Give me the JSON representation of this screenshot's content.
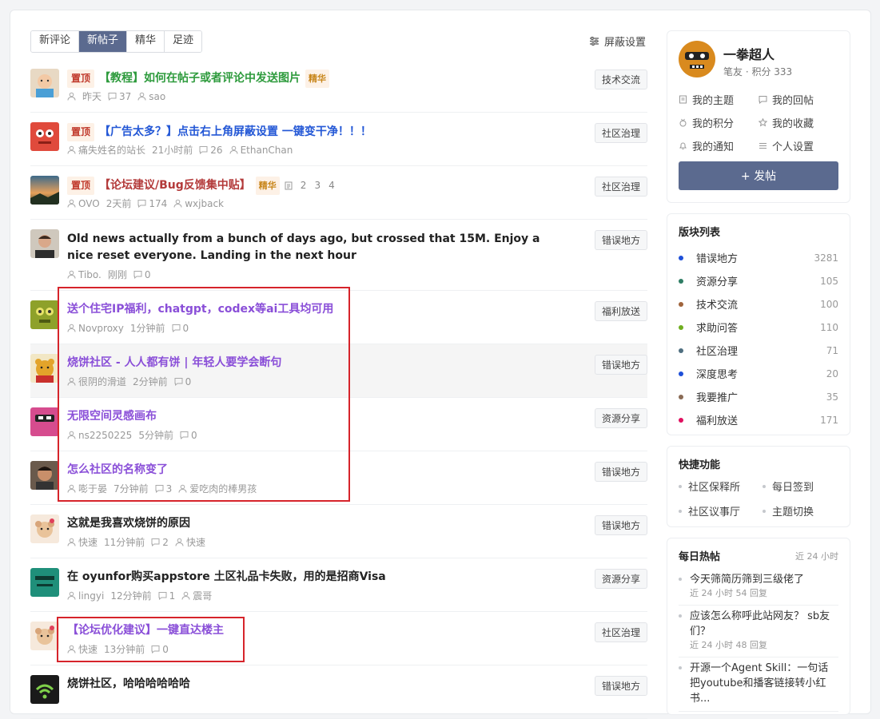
{
  "tabs": [
    {
      "label": "新评论",
      "active": false
    },
    {
      "label": "新帖子",
      "active": true
    },
    {
      "label": "精华",
      "active": false
    },
    {
      "label": "足迹",
      "active": false
    }
  ],
  "block_settings": "屏蔽设置",
  "posts": [
    {
      "pinned": "置顶",
      "title": "【教程】如何在帖子或者评论中发送图片",
      "best": "精华",
      "time": "昨天",
      "replies": "37",
      "last": "sao",
      "category": "技术交流"
    },
    {
      "pinned": "置顶",
      "title": "【广告太多？】点击右上角屏蔽设置 一键变干净！！！",
      "author": "痛失姓名的站长",
      "time": "21小时前",
      "replies": "26",
      "last": "EthanChan",
      "category": "社区治理"
    },
    {
      "pinned": "置顶",
      "title": "【论坛建议/Bug反馈集中贴】",
      "best": "精华",
      "pages": [
        "2",
        "3",
        "4"
      ],
      "author": "OVO",
      "time": "2天前",
      "replies": "174",
      "last": "wxjback",
      "category": "社区治理"
    },
    {
      "title": "Old news actually from a bunch of days ago, but crossed that 15M. Enjoy a nice reset everyone. Landing in the next hour",
      "author": "Tibo.",
      "time": "刚刚",
      "replies": "0",
      "category": "错误地方"
    },
    {
      "title": "送个住宅IP福利，chatgpt，codex等ai工具均可用",
      "author": "Novproxy",
      "time": "1分钟前",
      "replies": "0",
      "category": "福利放送"
    },
    {
      "title": "烧饼社区 - 人人都有饼 | 年轻人要学会断句",
      "author": "很阴的滑道",
      "time": "2分钟前",
      "replies": "0",
      "category": "错误地方"
    },
    {
      "title": "无限空间灵感画布",
      "author": "ns2250225",
      "time": "5分钟前",
      "replies": "0",
      "category": "资源分享"
    },
    {
      "title": "怎么社区的名称变了",
      "author": "嘭于晏",
      "time": "7分钟前",
      "replies": "3",
      "last": "爱吃肉的棒男孩",
      "category": "错误地方"
    },
    {
      "title": "这就是我喜欢烧饼的原因",
      "author": "快速",
      "time": "11分钟前",
      "replies": "2",
      "last": "快速",
      "category": "错误地方"
    },
    {
      "title": "在 oyunfor购买appstore 土区礼品卡失败，用的是招商Visa",
      "author": "lingyi",
      "time": "12分钟前",
      "replies": "1",
      "last": "震哥",
      "category": "资源分享"
    },
    {
      "title": "【论坛优化建议】一键直达楼主",
      "author": "快速",
      "time": "13分钟前",
      "replies": "0",
      "category": "社区治理"
    },
    {
      "title": "烧饼社区，哈哈哈哈哈哈",
      "category": "错误地方"
    }
  ],
  "user": {
    "name": "一拳超人",
    "sub": "笔友 · 积分 333",
    "links": [
      "我的主题",
      "我的回帖",
      "我的积分",
      "我的收藏",
      "我的通知",
      "个人设置"
    ],
    "post_button": "+ 发帖"
  },
  "forums": {
    "title": "版块列表",
    "items": [
      {
        "name": "错误地方",
        "count": "3281",
        "color": "#1e4fd8"
      },
      {
        "name": "资源分享",
        "count": "105",
        "color": "#2e7d64"
      },
      {
        "name": "技术交流",
        "count": "100",
        "color": "#a0643c"
      },
      {
        "name": "求助问答",
        "count": "110",
        "color": "#6fae1f"
      },
      {
        "name": "社区治理",
        "count": "71",
        "color": "#4f6f80"
      },
      {
        "name": "深度思考",
        "count": "20",
        "color": "#1e4fd8"
      },
      {
        "name": "我要推广",
        "count": "35",
        "color": "#8a6b55"
      },
      {
        "name": "福利放送",
        "count": "171",
        "color": "#e0105f"
      }
    ]
  },
  "quick": {
    "title": "快捷功能",
    "items": [
      "社区保释所",
      "每日签到",
      "社区议事厅",
      "主题切换"
    ]
  },
  "hot": {
    "title": "每日热帖",
    "range": "近 24 小时",
    "items": [
      {
        "title": "今天筛简历筛到三级佬了",
        "meta": "近 24 小时 54 回复"
      },
      {
        "title": "应该怎么称呼此站网友？ sb友们？",
        "meta": "近 24 小时 48 回复"
      },
      {
        "title": "开源一个Agent Skill：一句话把youtube和播客链接转小红书...",
        "meta": ""
      }
    ]
  }
}
